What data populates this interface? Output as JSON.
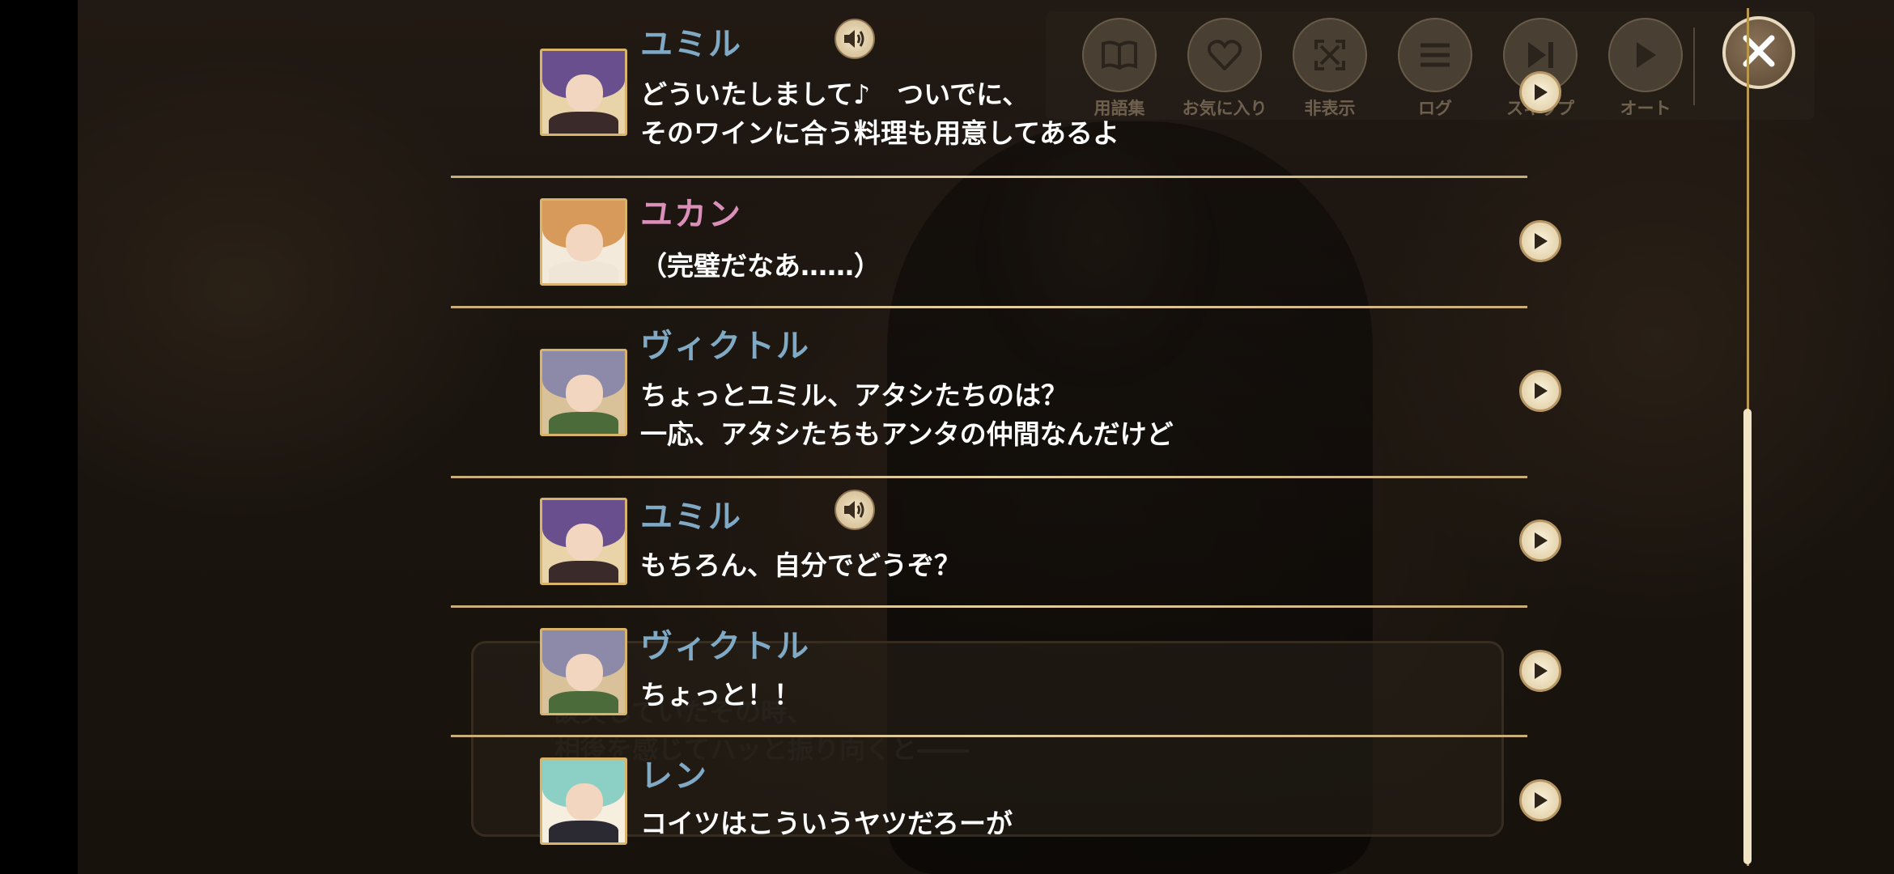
{
  "toolbar": {
    "buttons": [
      {
        "label": "用語集",
        "icon": "book-icon"
      },
      {
        "label": "お気に入り",
        "icon": "heart-icon"
      },
      {
        "label": "非表示",
        "icon": "fullscreen-icon"
      },
      {
        "label": "ログ",
        "icon": "menu-lines-icon"
      },
      {
        "label": "スキップ",
        "icon": "skip-icon"
      },
      {
        "label": "オート",
        "icon": "auto-play-icon"
      }
    ]
  },
  "background_story": {
    "line1": "談笑していたその時、",
    "line2": "相後を感じてハッと振り向くと――"
  },
  "log": {
    "entries": [
      {
        "name": "ユミル",
        "name_color": "#7fa9c4",
        "has_voice": true,
        "lines": [
          "どういたしまして♪　ついでに、",
          "そのワインに合う料理も用意してあるよ"
        ]
      },
      {
        "name": "ユカン",
        "name_color": "#d98fb8",
        "has_voice": false,
        "lines": [
          "（完璧だなあ……）"
        ]
      },
      {
        "name": "ヴィクトル",
        "name_color": "#7fa9c4",
        "has_voice": false,
        "lines": [
          "ちょっとユミル、アタシたちのは？",
          "一応、アタシたちもアンタの仲間なんだけど"
        ]
      },
      {
        "name": "ユミル",
        "name_color": "#7fa9c4",
        "has_voice": true,
        "lines": [
          "もちろん、自分でどうぞ？"
        ]
      },
      {
        "name": "ヴィクトル",
        "name_color": "#7fa9c4",
        "has_voice": false,
        "lines": [
          "ちょっと！！"
        ]
      },
      {
        "name": "レン",
        "name_color": "#7fa9c4",
        "has_voice": false,
        "lines": [
          "コイツはこういうヤツだろーが"
        ]
      }
    ]
  },
  "colors": {
    "separator": "#d9c290",
    "avatar_border": "#d8b36a",
    "text": "#ffffff"
  }
}
